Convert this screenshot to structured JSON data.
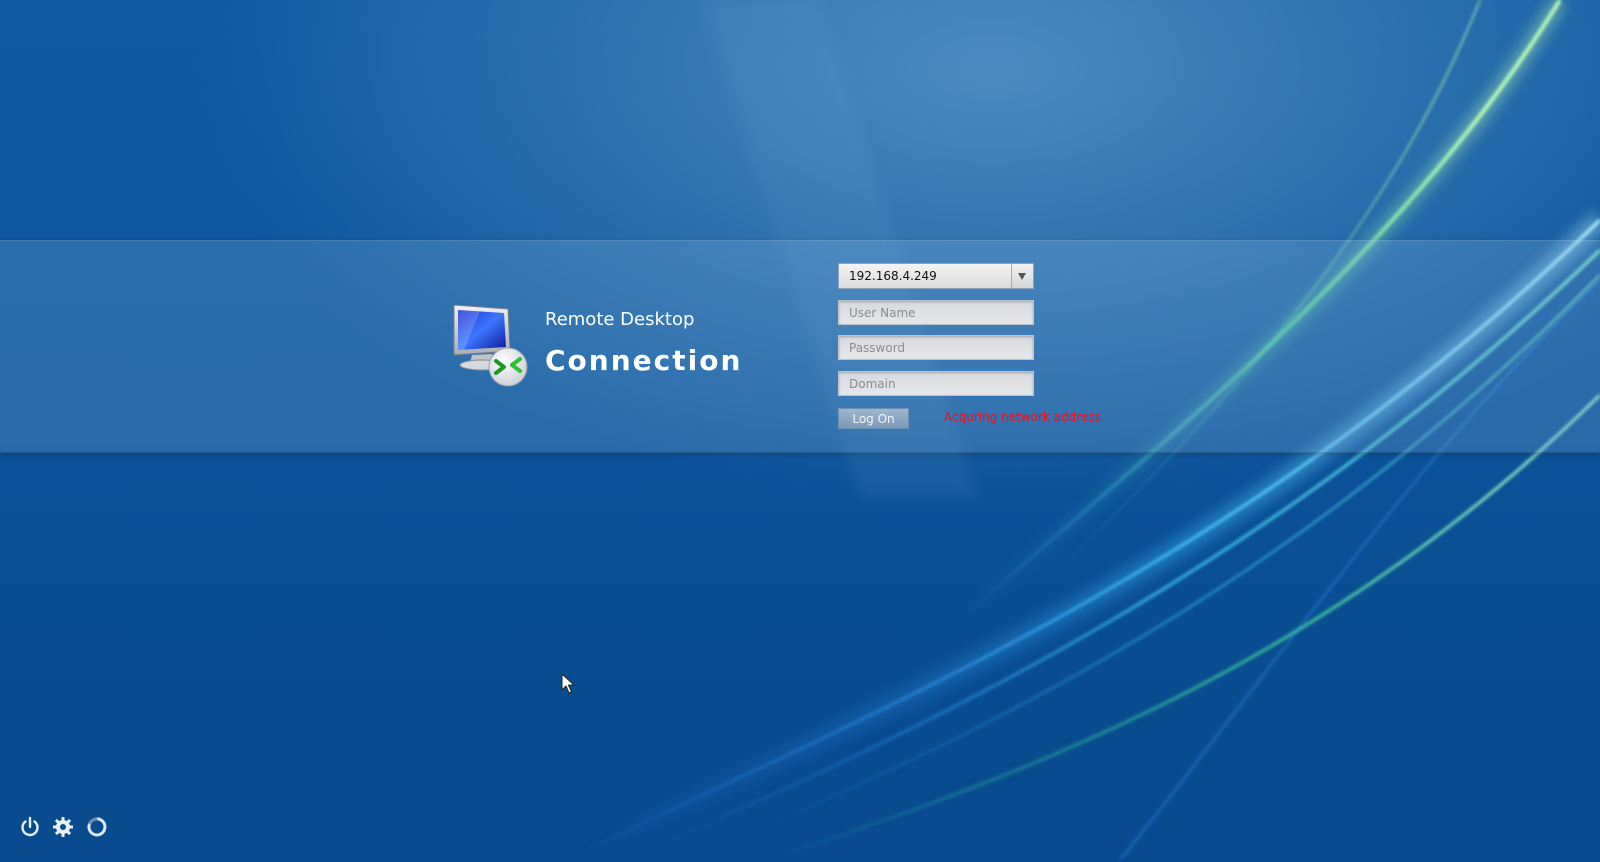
{
  "app": {
    "subtitle": "Remote Desktop",
    "title": "Connection"
  },
  "login": {
    "server": {
      "value": "192.168.4.249"
    },
    "username": {
      "placeholder": "User Name",
      "value": ""
    },
    "password": {
      "placeholder": "Password",
      "value": ""
    },
    "domain": {
      "placeholder": "Domain",
      "value": ""
    },
    "logon_label": "Log On",
    "status_message": "Acquring network address"
  },
  "tray": {
    "icons": [
      "power-icon",
      "gear-icon",
      "spinner-icon"
    ]
  },
  "colors": {
    "background": "#0b559c",
    "status_error": "#e8111c",
    "logon_button": "#8aa5c2"
  }
}
